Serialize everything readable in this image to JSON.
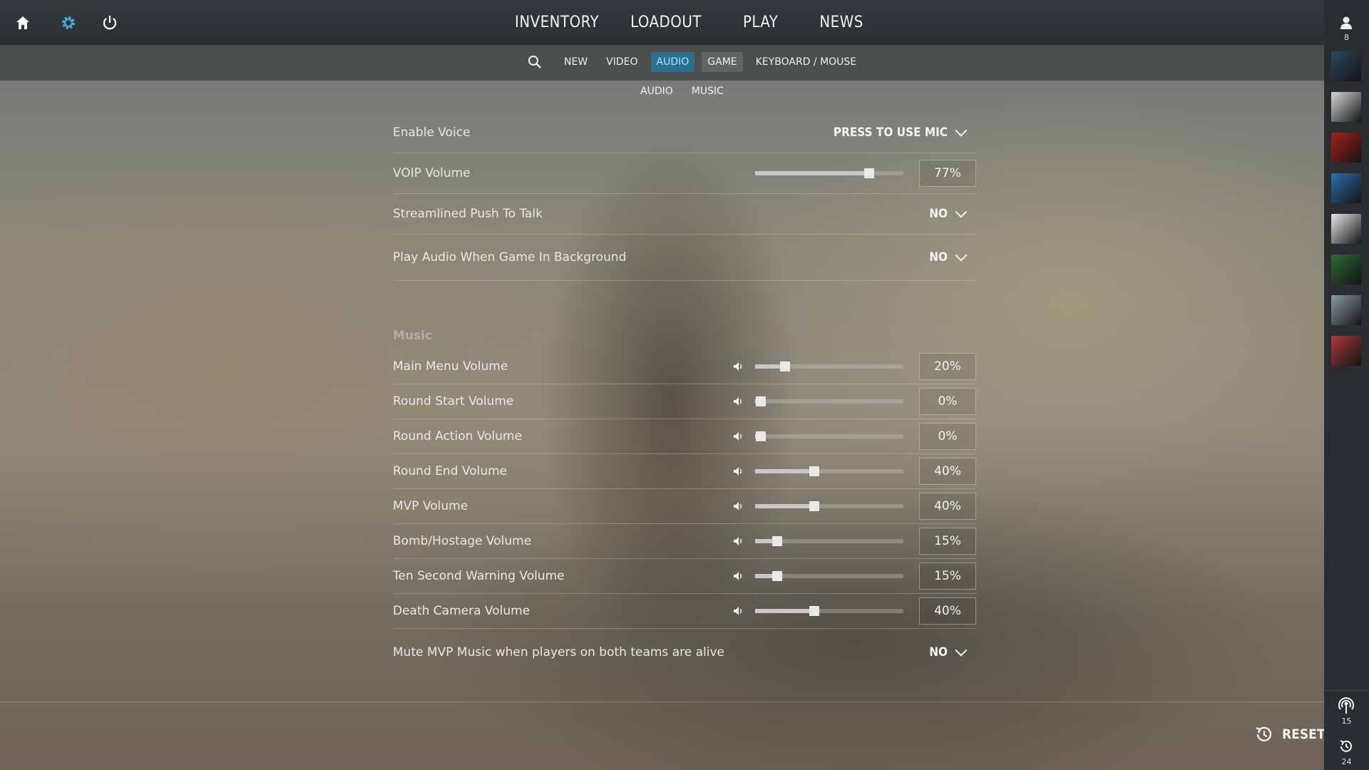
{
  "topbar": {
    "nav": [
      "INVENTORY",
      "LOADOUT",
      "PLAY",
      "NEWS"
    ],
    "icons": [
      "home-icon",
      "gear-icon",
      "power-icon"
    ]
  },
  "tabs": {
    "items": [
      "NEW",
      "VIDEO",
      "AUDIO",
      "GAME",
      "KEYBOARD / MOUSE"
    ],
    "active": "AUDIO"
  },
  "subtabs": [
    "AUDIO",
    "MUSIC"
  ],
  "audio_settings": {
    "enable_voice": {
      "label": "Enable Voice",
      "value": "PRESS TO USE MIC"
    },
    "voip_volume": {
      "label": "VOIP Volume",
      "value": "77%",
      "level": 0.77
    },
    "streamlined_ptt": {
      "label": "Streamlined Push To Talk",
      "value": "NO"
    },
    "play_background": {
      "label": "Play Audio When Game In Background",
      "value": "NO"
    }
  },
  "music": {
    "title": "Music",
    "rows": [
      {
        "label": "Main Menu Volume",
        "value": "20%",
        "level": 0.2
      },
      {
        "label": "Round Start Volume",
        "value": "0%",
        "level": 0.0
      },
      {
        "label": "Round Action Volume",
        "value": "0%",
        "level": 0.0
      },
      {
        "label": "Round End Volume",
        "value": "40%",
        "level": 0.4
      },
      {
        "label": "MVP Volume",
        "value": "40%",
        "level": 0.4
      },
      {
        "label": "Bomb/Hostage Volume",
        "value": "15%",
        "level": 0.15
      },
      {
        "label": "Ten Second Warning Volume",
        "value": "15%",
        "level": 0.15
      },
      {
        "label": "Death Camera Volume",
        "value": "40%",
        "level": 0.4
      }
    ],
    "mute_mvp": {
      "label": "Mute MVP Music when players on both teams are alive",
      "value": "NO"
    }
  },
  "sidebar": {
    "friends_count": "8",
    "broadcast_count": "15",
    "history_count": "24",
    "avatar_colors": [
      "#2a4a5a",
      "#d8d8d8",
      "#a8201a",
      "#2f6fae",
      "#e8e8e8",
      "#2e6a34",
      "#8a9aa8",
      "#b03a3a"
    ]
  },
  "reset_label": "RESET",
  "colors": {
    "accent": "#2d6f8f",
    "accent_text": "#a9e3ff",
    "gear": "#4aa8d8"
  }
}
